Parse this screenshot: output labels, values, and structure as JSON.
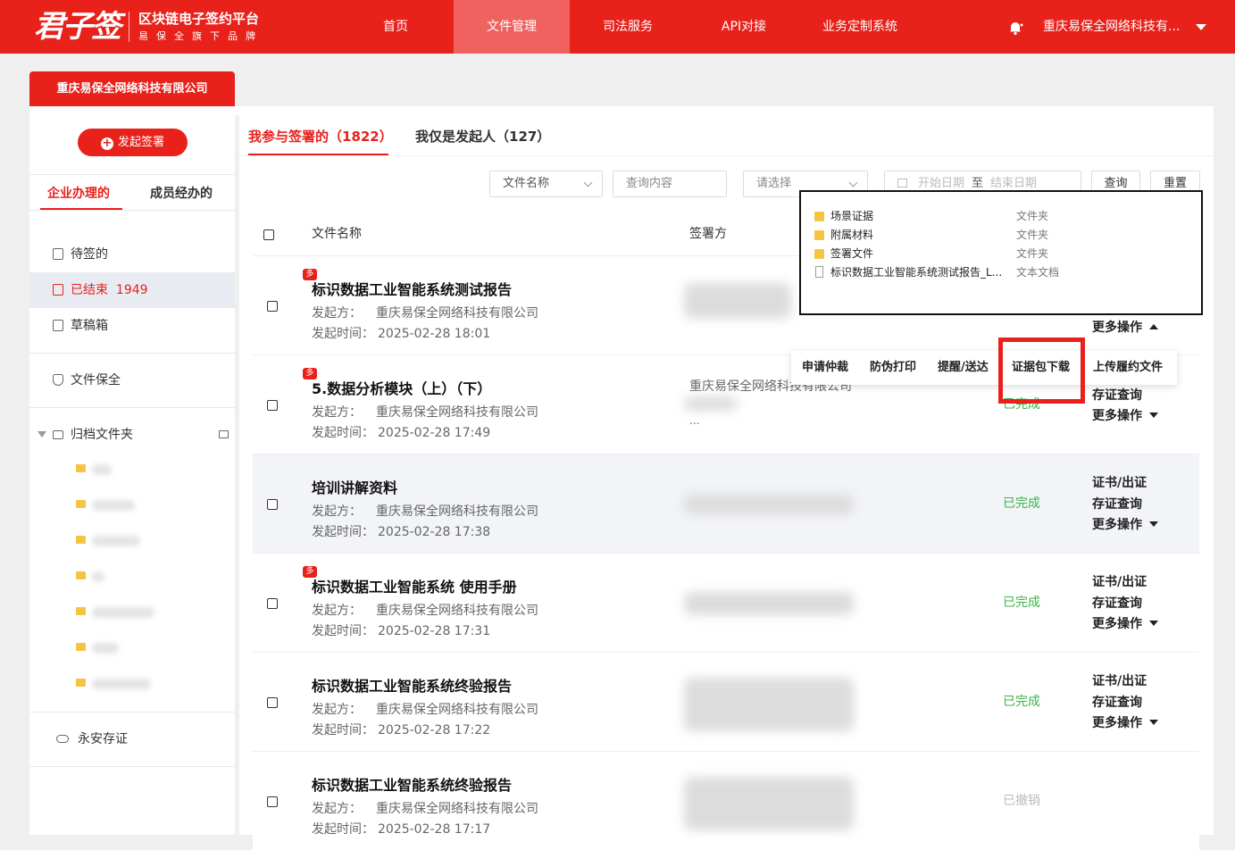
{
  "brand": {
    "logo": "君子签",
    "title": "区块链电子签约平台",
    "subtitle": "易保全旗下品牌"
  },
  "nav": [
    "首页",
    "文件管理",
    "司法服务",
    "API对接",
    "业务定制系统"
  ],
  "header_company": "重庆易保全网络科技有...",
  "company_tab": "重庆易保全网络科技有限公司",
  "sidebar": {
    "start_button": "发起签署",
    "tabs": [
      "企业办理的",
      "成员经办的"
    ],
    "items": {
      "pending": "待签的",
      "done": "已结束",
      "done_count": "1949",
      "drafts": "草稿箱",
      "preserve": "文件保全",
      "archive": "归档文件夹",
      "yongan": "永安存证"
    }
  },
  "main_tabs": [
    "我参与签署的（1822）",
    "我仅是发起人（127）"
  ],
  "filters": {
    "field_select": "文件名称",
    "query_placeholder": "查询内容",
    "status_placeholder": "请选择",
    "start_date": "开始日期",
    "to": "至",
    "end_date": "结束日期",
    "search_button": "查询",
    "reset_button": "重置"
  },
  "table": {
    "headers": {
      "name": "文件名称",
      "signers": "签署方"
    },
    "rows": [
      {
        "title": "标识数据工业智能系统测试报告",
        "multi": true,
        "initiator_label": "发起方：",
        "initiator": "重庆易保全网络科技有限公司",
        "time_label": "发起时间：",
        "time": "2025-02-28 18:01",
        "status": "",
        "signer": ""
      },
      {
        "title": "5.数据分析模块（上）（下）",
        "multi": true,
        "initiator_label": "发起方：",
        "initiator": "重庆易保全网络科技有限公司",
        "time_label": "发起时间：",
        "time": "2025-02-28 17:49",
        "status": "已完成",
        "signer": "重庆易保全网络科技有限公司"
      },
      {
        "title": "培训讲解资料",
        "multi": false,
        "initiator_label": "发起方：",
        "initiator": "重庆易保全网络科技有限公司",
        "time_label": "发起时间：",
        "time": "2025-02-28 17:38",
        "status": "已完成",
        "signer": ""
      },
      {
        "title": "标识数据工业智能系统 使用手册",
        "multi": true,
        "initiator_label": "发起方：",
        "initiator": "重庆易保全网络科技有限公司",
        "time_label": "发起时间：",
        "time": "2025-02-28 17:31",
        "status": "已完成",
        "signer": ""
      },
      {
        "title": "标识数据工业智能系统终验报告",
        "multi": false,
        "initiator_label": "发起方：",
        "initiator": "重庆易保全网络科技有限公司",
        "time_label": "发起时间：",
        "time": "2025-02-28 17:22",
        "status": "已完成",
        "signer": ""
      },
      {
        "title": "标识数据工业智能系统终验报告",
        "multi": false,
        "initiator_label": "发起方：",
        "initiator": "重庆易保全网络科技有限公司",
        "time_label": "发起时间：",
        "time": "2025-02-28 17:17",
        "status": "已撤销",
        "signer": ""
      }
    ],
    "multi_badge": "多",
    "ellipsis": "...",
    "ops": {
      "cert": "证书/出证",
      "evidence": "存证查询",
      "more": "更多操作"
    }
  },
  "popup": {
    "items": [
      {
        "name": "场景证据",
        "type": "文件夹",
        "icon": "folder-icon"
      },
      {
        "name": "附属材料",
        "type": "文件夹",
        "icon": "folder-icon"
      },
      {
        "name": "签署文件",
        "type": "文件夹",
        "icon": "folder-icon"
      },
      {
        "name": "标识数据工业智能系统测试报告_L...",
        "type": "文本文档",
        "icon": "document-icon"
      }
    ]
  },
  "more_menu": [
    "申请仲裁",
    "防伪打印",
    "提醒/送达",
    "证据包下载",
    "上传履约文件"
  ],
  "colors": {
    "brand_red": "#e8211b",
    "status_done": "#3bb44a",
    "status_revoked": "#bbbbbb"
  }
}
